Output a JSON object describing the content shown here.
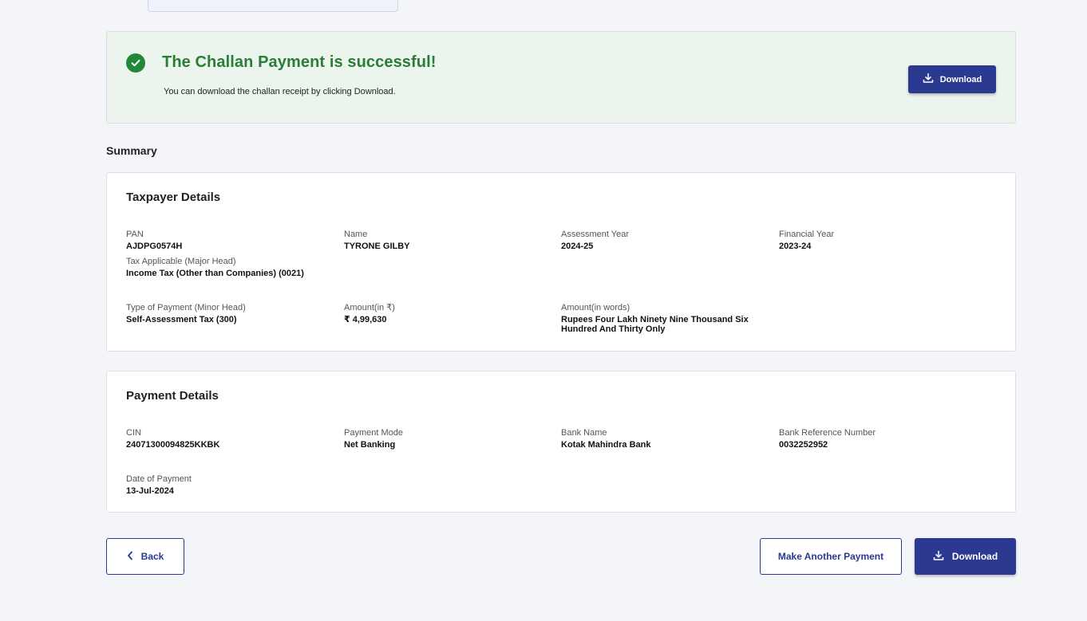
{
  "banner": {
    "title": "The Challan Payment is successful!",
    "subtitle": "You can download the challan receipt by clicking Download.",
    "download_label": "Download"
  },
  "summary_heading": "Summary",
  "taxpayer": {
    "title": "Taxpayer Details",
    "fields": {
      "pan": {
        "label": "PAN",
        "value": "AJDPG0574H"
      },
      "name": {
        "label": "Name",
        "value": "TYRONE GILBY"
      },
      "ay": {
        "label": "Assessment Year",
        "value": "2024-25"
      },
      "fy": {
        "label": "Financial Year",
        "value": "2023-24"
      },
      "tax_applicable": {
        "label": "Tax Applicable (Major Head)",
        "value": "Income Tax (Other than Companies) (0021)"
      },
      "payment_type": {
        "label": "Type of Payment (Minor Head)",
        "value": "Self-Assessment Tax (300)"
      },
      "amount": {
        "label": "Amount(in ₹)",
        "value": "₹ 4,99,630"
      },
      "amount_words": {
        "label": "Amount(in words)",
        "value": "Rupees Four Lakh Ninety Nine Thousand Six Hundred And Thirty Only"
      }
    }
  },
  "payment": {
    "title": "Payment Details",
    "fields": {
      "cin": {
        "label": "CIN",
        "value": "24071300094825KKBK"
      },
      "mode": {
        "label": "Payment Mode",
        "value": "Net Banking"
      },
      "bank": {
        "label": "Bank Name",
        "value": "Kotak Mahindra Bank"
      },
      "bank_ref": {
        "label": "Bank Reference Number",
        "value": "0032252952"
      },
      "date": {
        "label": "Date of Payment",
        "value": "13-Jul-2024"
      }
    }
  },
  "footer": {
    "back_label": "Back",
    "another_label": "Make Another Payment",
    "download_label": "Download"
  },
  "colors": {
    "primary": "#2b3990",
    "success": "#2a7d35",
    "banner_bg": "#ebf5ee",
    "page_bg": "#f4f5f9"
  },
  "icons": [
    "check-circle-icon",
    "download-icon",
    "chevron-left-icon"
  ]
}
